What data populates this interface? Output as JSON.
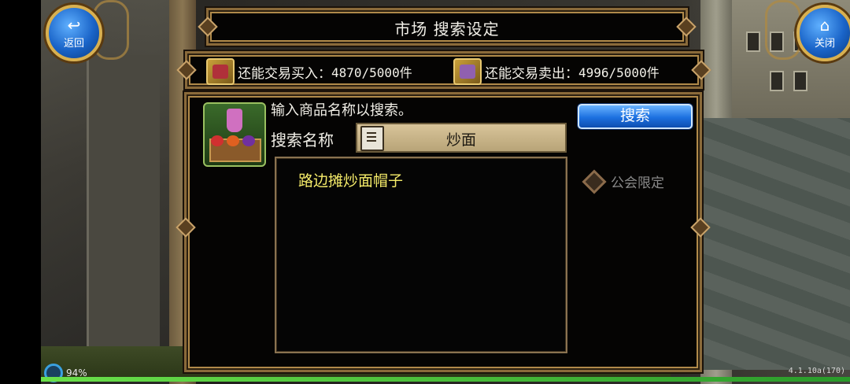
{
  "header": {
    "title": "市场  搜索设定"
  },
  "nav": {
    "back_label": "返回",
    "close_label": "关闭"
  },
  "trade": {
    "buy_label": "还能交易买入：",
    "buy_value": "4870/5000件",
    "sell_label": "还能交易卖出：",
    "sell_value": "4996/5000件"
  },
  "search": {
    "prompt": "输入商品名称以搜索。",
    "name_label": "搜索名称",
    "query": "炒面",
    "button_label": "搜索",
    "results": [
      "路边摊炒面帽子"
    ],
    "guild_limit_label": "公会限定"
  },
  "status": {
    "battery": "94%",
    "version": "4.1.10a(170)",
    "exp_progress": 1.0
  },
  "colors": {
    "accent": "#1c70e0",
    "result_text": "#f6ec6a",
    "frame_gold": "#b08a4a"
  }
}
